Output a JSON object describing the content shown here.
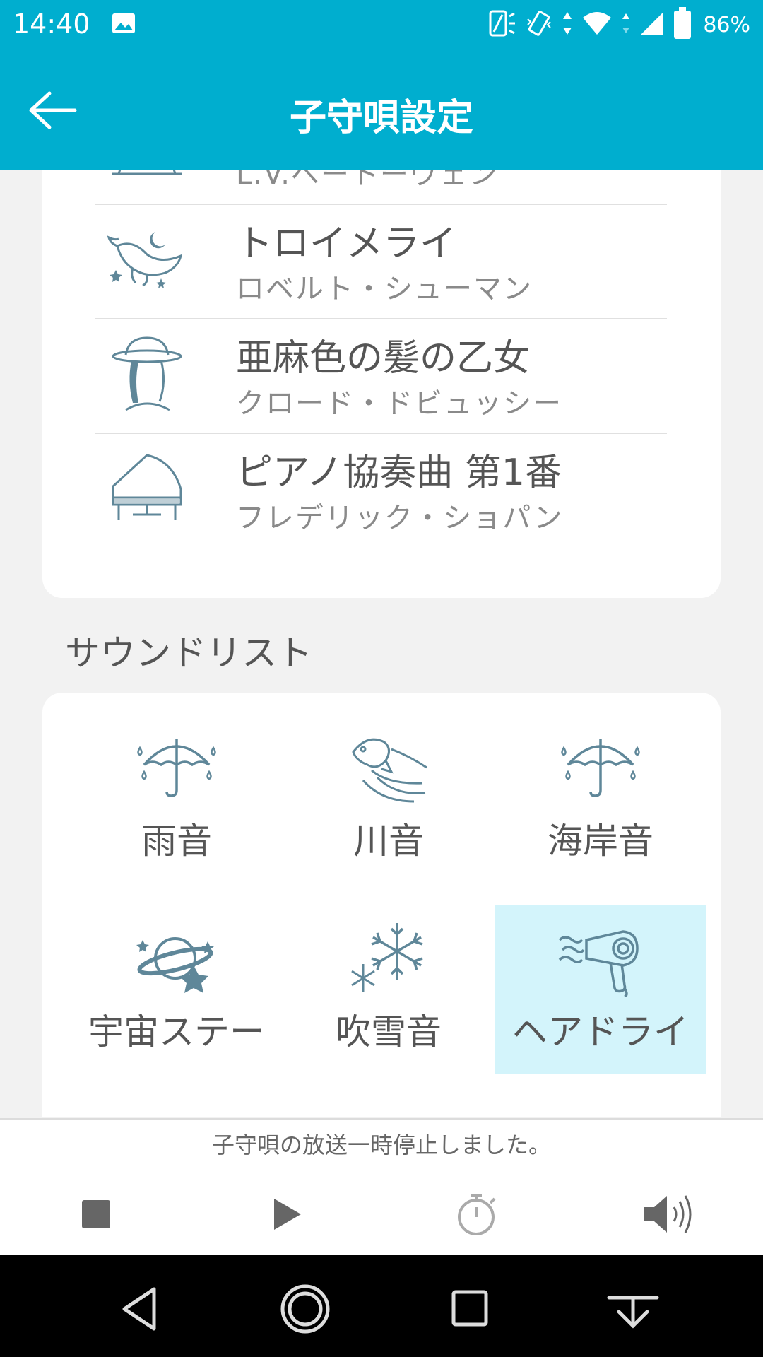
{
  "status_bar": {
    "time": "14:40",
    "battery": "86%"
  },
  "header": {
    "title": "子守唄設定",
    "back_icon": "arrow-left-icon"
  },
  "lullabies": [
    {
      "title": "",
      "artist": "L.V.ベートーヴェン",
      "icon": "cut-off-icon"
    },
    {
      "title": "トロイメライ",
      "artist": "ロベルト・シューマン",
      "icon": "whale-moon-icon"
    },
    {
      "title": "亜麻色の髪の乙女",
      "artist": "クロード・ドビュッシー",
      "icon": "girl-hat-icon"
    },
    {
      "title": "ピアノ協奏曲 第1番",
      "artist": "フレデリック・ショパン",
      "icon": "grand-piano-icon"
    }
  ],
  "sound_section_title": "サウンドリスト",
  "sounds": [
    {
      "label": "雨音",
      "icon": "umbrella-rain-icon",
      "selected": false
    },
    {
      "label": "川音",
      "icon": "fish-river-icon",
      "selected": false
    },
    {
      "label": "海岸音",
      "icon": "umbrella-rain-icon",
      "selected": false
    },
    {
      "label": "宇宙ステー",
      "icon": "planet-stars-icon",
      "selected": false
    },
    {
      "label": "吹雪音",
      "icon": "snowflake-icon",
      "selected": false
    },
    {
      "label": "ヘアドライ",
      "icon": "hair-dryer-icon",
      "selected": true
    }
  ],
  "status_message": "子守唄の放送一時停止しました。",
  "colors": {
    "accent": "#00aecf",
    "icon": "#5f8799",
    "selected_bg": "#d3f4fb"
  }
}
